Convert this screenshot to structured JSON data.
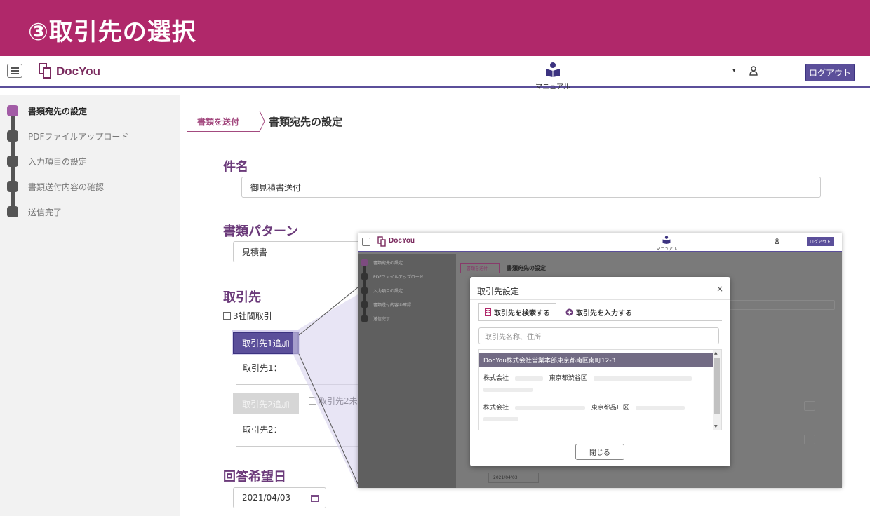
{
  "banner": {
    "title": "③取引先の選択"
  },
  "header": {
    "logo_text": "DocYou",
    "manual_label": "マニュアル",
    "caret": "▾",
    "logout_label": "ログアウト"
  },
  "sidebar": {
    "steps": [
      {
        "label": "書類宛先の設定",
        "active": true
      },
      {
        "label": "PDFファイルアップロード",
        "active": false
      },
      {
        "label": "入力項目の設定",
        "active": false
      },
      {
        "label": "書類送付内容の確認",
        "active": false
      },
      {
        "label": "送信完了",
        "active": false
      }
    ]
  },
  "breadcrumb": {
    "tag": "書類を送付",
    "title": "書類宛先の設定"
  },
  "form": {
    "subject_label": "件名",
    "subject_value": "御見積書送付",
    "pattern_label": "書類パターン",
    "pattern_value": "見積書",
    "partner_label": "取引先",
    "three_party_label": "3社間取引",
    "add_partner1_label": "取引先1追加",
    "partner1_label": "取引先1：",
    "add_partner2_label": "取引先2追加",
    "partner2_unset_label": "取引先2未",
    "partner2_label": "取引先2：",
    "answer_date_label": "回答希望日",
    "answer_date_value": "2021/04/03"
  },
  "inset": {
    "logo_text": "DocYou",
    "manual_label": "マニュアル",
    "logout_label": "ログアウト",
    "steps": [
      "書類宛先の設定",
      "PDFファイルアップロード",
      "入力項目の設定",
      "書類送付内容の確認",
      "送信完了"
    ],
    "crumb_tag": "書類を送付",
    "crumb_title": "書類宛先の設定",
    "date_value": "2021/04/03"
  },
  "modal": {
    "title": "取引先設定",
    "close_glyph": "×",
    "tab_search": "取引先を検索する",
    "tab_input": "取引先を入力する",
    "search_placeholder": "取引先名称、住所",
    "results": [
      {
        "text": "DocYou株式会社営業本部東京都南区南町12-3",
        "selected": true
      },
      {
        "company": "株式会社",
        "address": "東京都渋谷区",
        "selected": false
      },
      {
        "company": "株式会社",
        "address": "東京都品川区",
        "selected": false
      }
    ],
    "close_button": "閉じる"
  },
  "colors": {
    "banner": "#b0286a",
    "accent": "#5b4f9a",
    "section_label": "#6b3a7a",
    "active_step": "#a25ca6"
  }
}
